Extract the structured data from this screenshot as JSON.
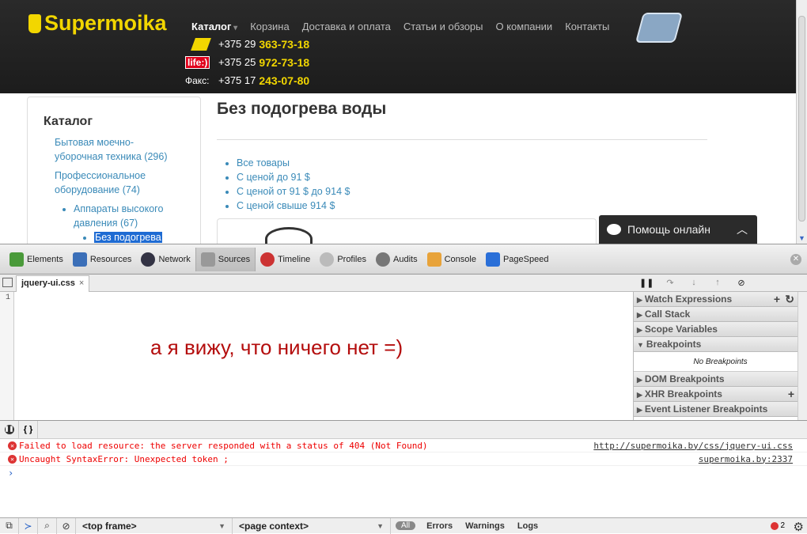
{
  "site": {
    "logo": "Supermoika",
    "nav": [
      "Каталог",
      "Корзина",
      "Доставка и оплата",
      "Статьи и обзоры",
      "О компании",
      "Контакты"
    ],
    "phones": [
      {
        "operator": "mts",
        "prefix": "+375 29",
        "number": "363-73-18"
      },
      {
        "operator": "life:)",
        "prefix": "+375 25",
        "number": "972-73-18"
      },
      {
        "operator": "Факс:",
        "prefix": "+375 17",
        "number": "243-07-80"
      }
    ],
    "sidebar": {
      "title": "Каталог",
      "items": [
        "Бытовая моечно-уборочная техника (296)",
        "Профессиональное оборудование (74)",
        "Аппараты высокого давления (67)",
        "Без подогрева"
      ]
    },
    "heading": "Без подогрева воды",
    "filters": [
      "Все товары",
      "С ценой до 91 $",
      "С ценой от 91 $ до 914 $",
      "С ценой свыше 914 $"
    ],
    "help": "Помощь онлайн"
  },
  "devtools": {
    "tabs": [
      "Elements",
      "Resources",
      "Network",
      "Sources",
      "Timeline",
      "Profiles",
      "Audits",
      "Console",
      "PageSpeed"
    ],
    "active_tab": "Sources",
    "file_tab": "jquery-ui.css",
    "line_number": "1",
    "overlay_text": "а я вижу, что ничего нет =)",
    "panels": [
      "Watch Expressions",
      "Call Stack",
      "Scope Variables",
      "Breakpoints",
      "DOM Breakpoints",
      "XHR Breakpoints",
      "Event Listener Breakpoints"
    ],
    "no_breakpoints": "No Breakpoints",
    "console_messages": [
      {
        "text": "Failed to load resource: the server responded with a status of 404 (Not Found)",
        "source": "http://supermoika.by/css/jquery-ui.css"
      },
      {
        "text": "Uncaught SyntaxError: Unexpected token ;",
        "source": "supermoika.by:2337"
      }
    ],
    "prompt": "›",
    "frame_select": "<top frame>",
    "context_select": "<page context>",
    "filters": [
      "All",
      "Errors",
      "Warnings",
      "Logs"
    ],
    "error_count": "2"
  }
}
